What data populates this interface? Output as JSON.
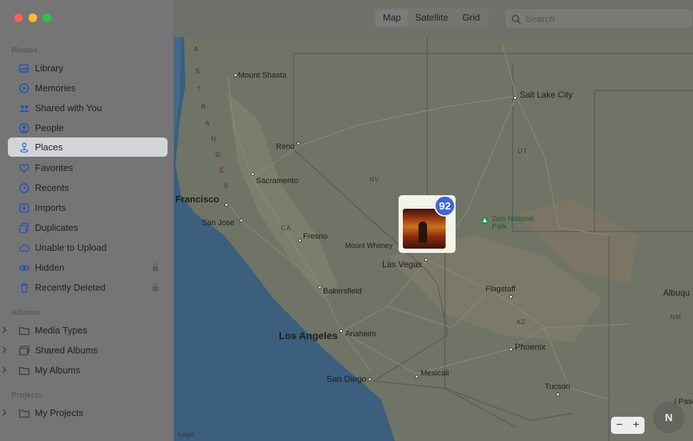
{
  "window": {
    "traffic_lights": [
      {
        "name": "close",
        "color": "#ff5f57"
      },
      {
        "name": "minimize",
        "color": "#febc2e"
      },
      {
        "name": "zoom",
        "color": "#28c840"
      }
    ]
  },
  "sidebar": {
    "photos_title": "Photos",
    "items": [
      {
        "label": "Library",
        "icon": "library-icon"
      },
      {
        "label": "Memories",
        "icon": "memories-icon"
      },
      {
        "label": "Shared with You",
        "icon": "shared-with-you-icon"
      },
      {
        "label": "People",
        "icon": "people-icon"
      },
      {
        "label": "Places",
        "icon": "places-icon",
        "selected": true
      },
      {
        "label": "Favorites",
        "icon": "heart-icon"
      },
      {
        "label": "Recents",
        "icon": "clock-icon"
      },
      {
        "label": "Imports",
        "icon": "imports-icon"
      },
      {
        "label": "Duplicates",
        "icon": "duplicates-icon"
      },
      {
        "label": "Unable to Upload",
        "icon": "cloud-icon"
      },
      {
        "label": "Hidden",
        "icon": "eye-icon",
        "locked": true
      },
      {
        "label": "Recently Deleted",
        "icon": "trash-icon",
        "locked": true
      }
    ],
    "albums_title": "Albums",
    "albums": [
      {
        "label": "Media Types",
        "icon": "folder-icon"
      },
      {
        "label": "Shared Albums",
        "icon": "shared-albums-icon"
      },
      {
        "label": "My Albums",
        "icon": "folder-icon"
      }
    ],
    "projects_title": "Projects",
    "projects": [
      {
        "label": "My Projects",
        "icon": "folder-icon"
      }
    ]
  },
  "toolbar": {
    "view_modes": [
      "Map",
      "Satellite",
      "Grid"
    ],
    "selected_view": "Map",
    "search_placeholder": "Search"
  },
  "map": {
    "places": {
      "mount_shasta": "Mount Shasta",
      "salt_lake_city": "Salt Lake City",
      "reno": "Reno",
      "sacramento": "Sacramento",
      "francisco": "Francisco",
      "san_jose": "San Jose",
      "fresno": "Fresno",
      "mount_whitney": "Mount Whitney",
      "las_vegas": "Las Vegas",
      "bakersfield": "Bakersfield",
      "los_angeles": "Los Angeles",
      "anaheim": "Anaheim",
      "san_diego": "San Diego",
      "mexicali": "Mexicali",
      "flagstaff": "Flagstaff",
      "phoenix": "Phoenix",
      "tucson": "Tucson",
      "albuquerque": "Albuqu",
      "el_paso": "l Paso",
      "zion": "Zion National",
      "zion2": "Park"
    },
    "states": {
      "nv": "NV",
      "ut": "UT",
      "ca": "CA",
      "az": "AZ",
      "nm": "NM"
    },
    "range_letters": [
      "A",
      "S",
      "T",
      "R",
      "A",
      "N",
      "G",
      "E",
      "S"
    ],
    "photo_count": "92",
    "zoom_out": "−",
    "zoom_in": "+",
    "compass": "N",
    "legal": "Legal"
  },
  "colors": {
    "sidebar_bg": "#757575",
    "selected_bg": "#d3d4d8",
    "accent_blue": "#3d66d8",
    "ocean": "#3b5f7d",
    "land": "#6f7466"
  }
}
